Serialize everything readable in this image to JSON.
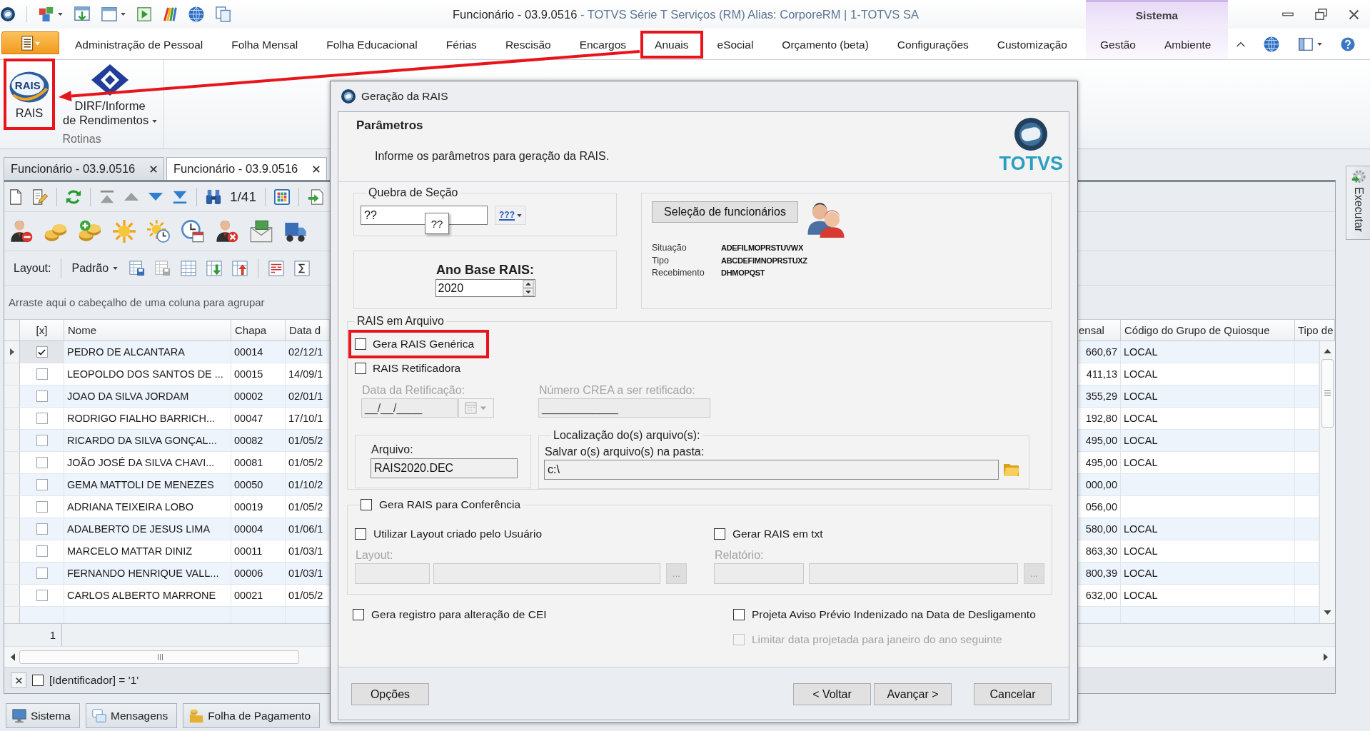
{
  "window": {
    "title": "Funcionário - 03.9.0516",
    "subtitle": "- TOTVS Série T Serviços (RM) Alias: CorporeRM | 1-TOTVS SA"
  },
  "ribbon": {
    "tabs": [
      {
        "label": "Administração de Pessoal",
        "highlighted": false
      },
      {
        "label": "Folha Mensal",
        "highlighted": false
      },
      {
        "label": "Folha Educacional",
        "highlighted": false
      },
      {
        "label": "Férias",
        "highlighted": false
      },
      {
        "label": "Rescisão",
        "highlighted": false
      },
      {
        "label": "Encargos",
        "highlighted": false
      },
      {
        "label": "Anuais",
        "highlighted": true
      },
      {
        "label": "eSocial",
        "highlighted": false
      },
      {
        "label": "Orçamento (beta)",
        "highlighted": false
      },
      {
        "label": "Configurações",
        "highlighted": false
      },
      {
        "label": "Customização",
        "highlighted": false
      }
    ],
    "context_group": {
      "label": "Sistema",
      "tabs": [
        {
          "label": "Gestão",
          "highlighted": false
        },
        {
          "label": "Ambiente",
          "highlighted": false
        }
      ]
    },
    "groups": [
      {
        "label": "Rotinas",
        "buttons": [
          {
            "kind": "rais",
            "label_lines": [
              "RAIS"
            ],
            "logo_text": "RAIS",
            "dropdown": false,
            "highlighted": true
          },
          {
            "kind": "dirf",
            "label_lines": [
              "DIRF/Informe",
              "de Rendimentos"
            ],
            "dropdown": true,
            "highlighted": false
          }
        ]
      }
    ]
  },
  "document_tabs": [
    {
      "label": "Funcionário - 03.9.0516",
      "selected": false
    },
    {
      "label": "Funcionário - 03.9.0516",
      "selected": true
    }
  ],
  "toolbar": {
    "record_counter": "1/41",
    "layout_label": "Layout:",
    "layout_value": "Padrão"
  },
  "group_panel": {
    "hint": "Arraste aqui o cabeçalho de uma coluna para agrupar"
  },
  "grid": {
    "columns": [
      "[x]",
      "Nome",
      "Chapa",
      "Data d",
      "ensal",
      "Código do Grupo de Quiosque",
      "Tipo de"
    ],
    "rows": [
      {
        "selected": true,
        "checked": true,
        "nome": "PEDRO DE ALCANTARA",
        "chapa": "00014",
        "column_4": "02/12/1",
        "column_5": "660,67",
        "codigo_do_grupo_de_quiosque": "LOCAL"
      },
      {
        "selected": false,
        "checked": false,
        "nome": "LEOPOLDO DOS SANTOS DE ...",
        "chapa": "00015",
        "column_4": "14/09/1",
        "column_5": "411,13",
        "codigo_do_grupo_de_quiosque": "LOCAL"
      },
      {
        "selected": false,
        "checked": false,
        "nome": "JOAO DA SILVA JORDAM",
        "chapa": "00002",
        "column_4": "02/01/1",
        "column_5": "355,29",
        "codigo_do_grupo_de_quiosque": "LOCAL"
      },
      {
        "selected": false,
        "checked": false,
        "nome": "RODRIGO FIALHO BARRICH...",
        "chapa": "00047",
        "column_4": "17/10/1",
        "column_5": "192,80",
        "codigo_do_grupo_de_quiosque": "LOCAL"
      },
      {
        "selected": false,
        "checked": false,
        "nome": "RICARDO DA SILVA GONÇAL...",
        "chapa": "00082",
        "column_4": "01/05/2",
        "column_5": "495,00",
        "codigo_do_grupo_de_quiosque": "LOCAL"
      },
      {
        "selected": false,
        "checked": false,
        "nome": "JOÃO JOSÉ DA SILVA CHAVI...",
        "chapa": "00081",
        "column_4": "01/05/2",
        "column_5": "495,00",
        "codigo_do_grupo_de_quiosque": "LOCAL"
      },
      {
        "selected": false,
        "checked": false,
        "nome": "GEMA MATTOLI DE MENEZES",
        "chapa": "00050",
        "column_4": "01/10/2",
        "column_5": "000,00"
      },
      {
        "selected": false,
        "checked": false,
        "nome": "ADRIANA TEIXEIRA LOBO",
        "chapa": "00019",
        "column_4": "01/05/2",
        "column_5": "056,00"
      },
      {
        "selected": false,
        "checked": false,
        "nome": "ADALBERTO DE JESUS LIMA",
        "chapa": "00004",
        "column_4": "01/06/1",
        "column_5": "580,00",
        "codigo_do_grupo_de_quiosque": "LOCAL"
      },
      {
        "selected": false,
        "checked": false,
        "nome": "MARCELO MATTAR DINIZ",
        "chapa": "00011",
        "column_4": "01/03/1",
        "column_5": "863,30",
        "codigo_do_grupo_de_quiosque": "LOCAL"
      },
      {
        "selected": false,
        "checked": false,
        "nome": "FERNANDO HENRIQUE VALL...",
        "chapa": "00006",
        "column_4": "01/03/1",
        "column_5": "800,39",
        "codigo_do_grupo_de_quiosque": "LOCAL"
      },
      {
        "selected": false,
        "checked": false,
        "nome": "CARLOS ALBERTO MARRONE",
        "chapa": "00021",
        "column_4": "01/05/2",
        "column_5": "632,00",
        "codigo_do_grupo_de_quiosque": "LOCAL"
      }
    ],
    "footer_count": "1"
  },
  "filter": {
    "checked": false,
    "text": "[Identificador] = '1'"
  },
  "bottom_tabs": [
    {
      "kind": "system",
      "label": "Sistema"
    },
    {
      "kind": "messages",
      "label": "Mensagens"
    },
    {
      "kind": "payroll",
      "label": "Folha de Pagamento"
    }
  ],
  "side_panel": {
    "label": "Executar"
  },
  "dialog": {
    "title": "Geração da RAIS",
    "header": {
      "title": "Parâmetros",
      "description": "Informe os parâmetros para geração da RAIS.",
      "brand": "TOTVS"
    },
    "section_break": {
      "legend": "Quebra de Seção",
      "value": "??",
      "tooltip": "??",
      "button_text": "???"
    },
    "base_year": {
      "label": "Ano Base RAIS:",
      "value": "2020"
    },
    "employee_selection": {
      "button": "Seleção de funcionários",
      "filters": [
        {
          "label": "Situação",
          "value": "ADEFILMOPRSTUVWX"
        },
        {
          "label": "Tipo",
          "value": "ABCDEFIMNOPRSTUXZ"
        },
        {
          "label": "Recebimento",
          "value": "DHMOPQST"
        }
      ]
    },
    "file_output": {
      "legend": "RAIS em Arquivo",
      "options": [
        {
          "label": "Gera RAIS Genérica",
          "checked": false,
          "highlighted": true
        },
        {
          "label": "RAIS Retificadora",
          "checked": false,
          "highlighted": false
        }
      ],
      "fields": [
        {
          "kind": "date",
          "label": "Data da Retificação:",
          "value": "__/__/____",
          "disabled": true
        },
        {
          "kind": "text",
          "label": "Número CREA a ser retificado:",
          "value": "____________",
          "disabled": true
        }
      ],
      "file": {
        "label": "Arquivo:",
        "value": "RAIS2020.DEC"
      },
      "location": {
        "legend": "Localização do(s) arquivo(s):",
        "label": "Salvar o(s) arquivo(s) na pasta:",
        "value": "c:\\"
      }
    },
    "conference": {
      "label": "Gera RAIS para Conferência",
      "checked": false,
      "options": [
        {
          "label": "Utilizar Layout criado pelo Usuário",
          "checked": false,
          "field_label": "Layout:",
          "button": "...",
          "fields_disabled": true
        },
        {
          "label": "Gerar RAIS em txt",
          "checked": false,
          "field_label": "Relatório:",
          "button": "...",
          "fields_disabled": true
        }
      ]
    },
    "option_columns": [
      [
        {
          "label": "Gera registro para alteração de CEI",
          "checked": false,
          "disabled": false
        }
      ],
      [
        {
          "label": "Projeta Aviso Prévio Indenizado na Data de Desligamento",
          "checked": false,
          "disabled": false
        },
        {
          "label": "Limitar data projetada para janeiro do ano seguinte",
          "checked": false,
          "disabled": true
        }
      ]
    ],
    "buttons": {
      "left": [
        {
          "label": "Opções"
        }
      ],
      "right": [
        {
          "label": "< Voltar"
        },
        {
          "label": "Avançar >"
        },
        {
          "label": "Cancelar"
        }
      ]
    }
  }
}
